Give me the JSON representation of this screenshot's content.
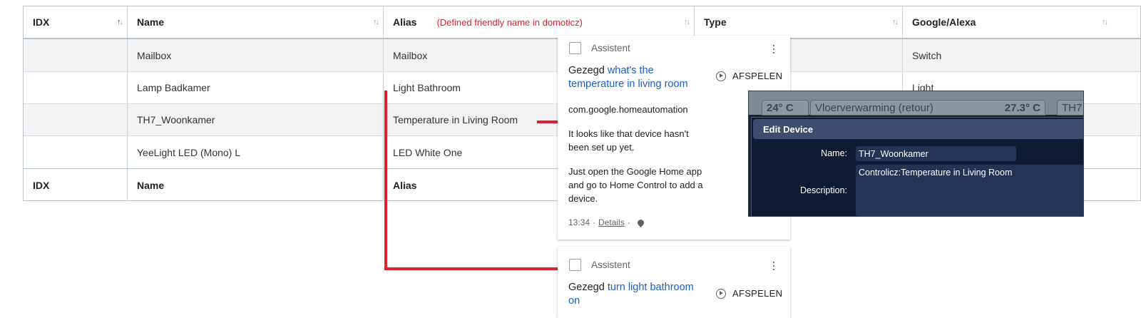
{
  "table": {
    "headers": [
      "IDX",
      "Name",
      "Alias",
      "Type",
      "Google/Alexa"
    ],
    "annotation": "(Defined friendly name in domoticz)",
    "rows": [
      {
        "idx": "",
        "name": "Mailbox",
        "alias": "Mailbox",
        "type": "",
        "google": "Switch"
      },
      {
        "idx": "",
        "name": "Lamp Badkamer",
        "alias": "Light Bathroom",
        "type": "",
        "google": "Light"
      },
      {
        "idx": "",
        "name": "TH7_Woonkamer",
        "alias": "Temperature in Living Room",
        "type": "",
        "google": ""
      },
      {
        "idx": "",
        "name": "YeeLight LED (Mono) L",
        "alias": "LED White One",
        "type": "",
        "google": ""
      }
    ],
    "footers": [
      "IDX",
      "Name",
      "Alias"
    ]
  },
  "cards": [
    {
      "assistant_label": "Assistent",
      "said_prefix": "Gezegd",
      "query": "what's the temperature in living room",
      "play_label": "AFSPELEN",
      "app": "com.google.homeautomation",
      "reply1": "It looks like that device hasn't been set up yet.",
      "reply2": "Just open the Google Home app and go to Home Control to add a device.",
      "time": "13:34",
      "details": "Details"
    },
    {
      "assistant_label": "Assistent",
      "said_prefix": "Gezegd",
      "query": "turn light bathroom on",
      "play_label": "AFSPELEN"
    }
  ],
  "domoticz": {
    "tiles": [
      "24° C",
      "Vloerverwarming (retour)",
      "27.3° C",
      "TH7"
    ],
    "dialog_title": "Edit Device",
    "name_label": "Name:",
    "name_value": "TH7_Woonkamer",
    "desc_label": "Description:",
    "desc_value": "Controlicz:Temperature in Living Room"
  },
  "colors": {
    "link": "#1a5fc8",
    "annotation": "#e8202a",
    "connector": "#e0212b"
  }
}
